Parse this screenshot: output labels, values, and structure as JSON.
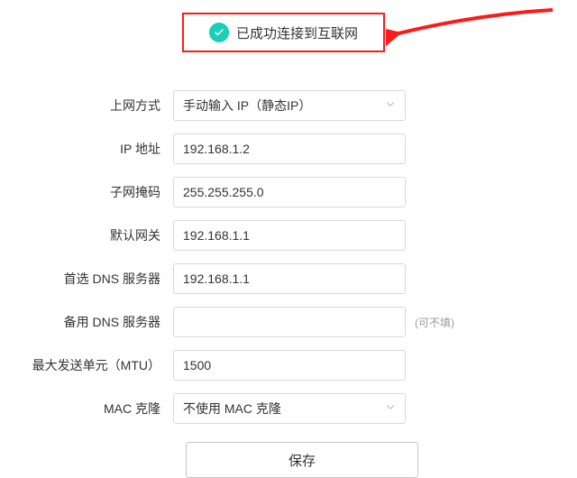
{
  "status": {
    "text": "已成功连接到互联网",
    "color": "#1aceb8"
  },
  "form": {
    "connection_mode": {
      "label": "上网方式",
      "value": "手动输入 IP（静态IP）"
    },
    "ip_address": {
      "label": "IP 地址",
      "value": "192.168.1.2"
    },
    "subnet_mask": {
      "label": "子网掩码",
      "value": "255.255.255.0"
    },
    "gateway": {
      "label": "默认网关",
      "value": "192.168.1.1"
    },
    "dns_primary": {
      "label": "首选 DNS 服务器",
      "value": "192.168.1.1"
    },
    "dns_secondary": {
      "label": "备用 DNS 服务器",
      "value": "",
      "hint": "(可不填)"
    },
    "mtu": {
      "label": "最大发送单元（MTU）",
      "value": "1500"
    },
    "mac_clone": {
      "label": "MAC 克隆",
      "value": "不使用 MAC 克隆"
    }
  },
  "buttons": {
    "save": "保存"
  },
  "annotation": {
    "highlight_color": "#ff1a1a"
  }
}
